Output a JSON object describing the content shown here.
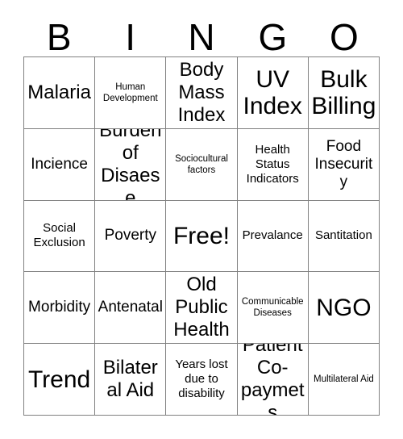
{
  "card": {
    "header_letters": [
      "B",
      "I",
      "N",
      "G",
      "O"
    ],
    "free_space_label": "Free!",
    "rows": [
      [
        {
          "label": "Malaria",
          "size": "lg"
        },
        {
          "label": "Human Development",
          "size": "xs"
        },
        {
          "label": "Body Mass Index",
          "size": "lg"
        },
        {
          "label": "UV Index",
          "size": "xl"
        },
        {
          "label": "Bulk Billing",
          "size": "xl"
        }
      ],
      [
        {
          "label": "Incience",
          "size": "md"
        },
        {
          "label": "Burden of Disaese",
          "size": "lg"
        },
        {
          "label": "Sociocultural factors",
          "size": "xs"
        },
        {
          "label": "Health Status Indicators",
          "size": "sm"
        },
        {
          "label": "Food Insecurity",
          "size": "md"
        }
      ],
      [
        {
          "label": "Social Exclusion",
          "size": "sm"
        },
        {
          "label": "Poverty",
          "size": "md"
        },
        {
          "label": "Free!",
          "size": "xl"
        },
        {
          "label": "Prevalance",
          "size": "sm"
        },
        {
          "label": "Santitation",
          "size": "sm"
        }
      ],
      [
        {
          "label": "Morbidity",
          "size": "md"
        },
        {
          "label": "Antenatal",
          "size": "md"
        },
        {
          "label": "Old Public Health",
          "size": "lg"
        },
        {
          "label": "Communicable Diseases",
          "size": "xs"
        },
        {
          "label": "NGO",
          "size": "xl"
        }
      ],
      [
        {
          "label": "Trend",
          "size": "xl"
        },
        {
          "label": "Bilateral Aid",
          "size": "lg"
        },
        {
          "label": "Years lost due to disability",
          "size": "sm"
        },
        {
          "label": "Patient Co-paymets",
          "size": "lg"
        },
        {
          "label": "Multilateral Aid",
          "size": "xs"
        }
      ]
    ]
  },
  "colors": {
    "background": "#ffffff",
    "text": "#000000",
    "grid_line": "#808080"
  }
}
